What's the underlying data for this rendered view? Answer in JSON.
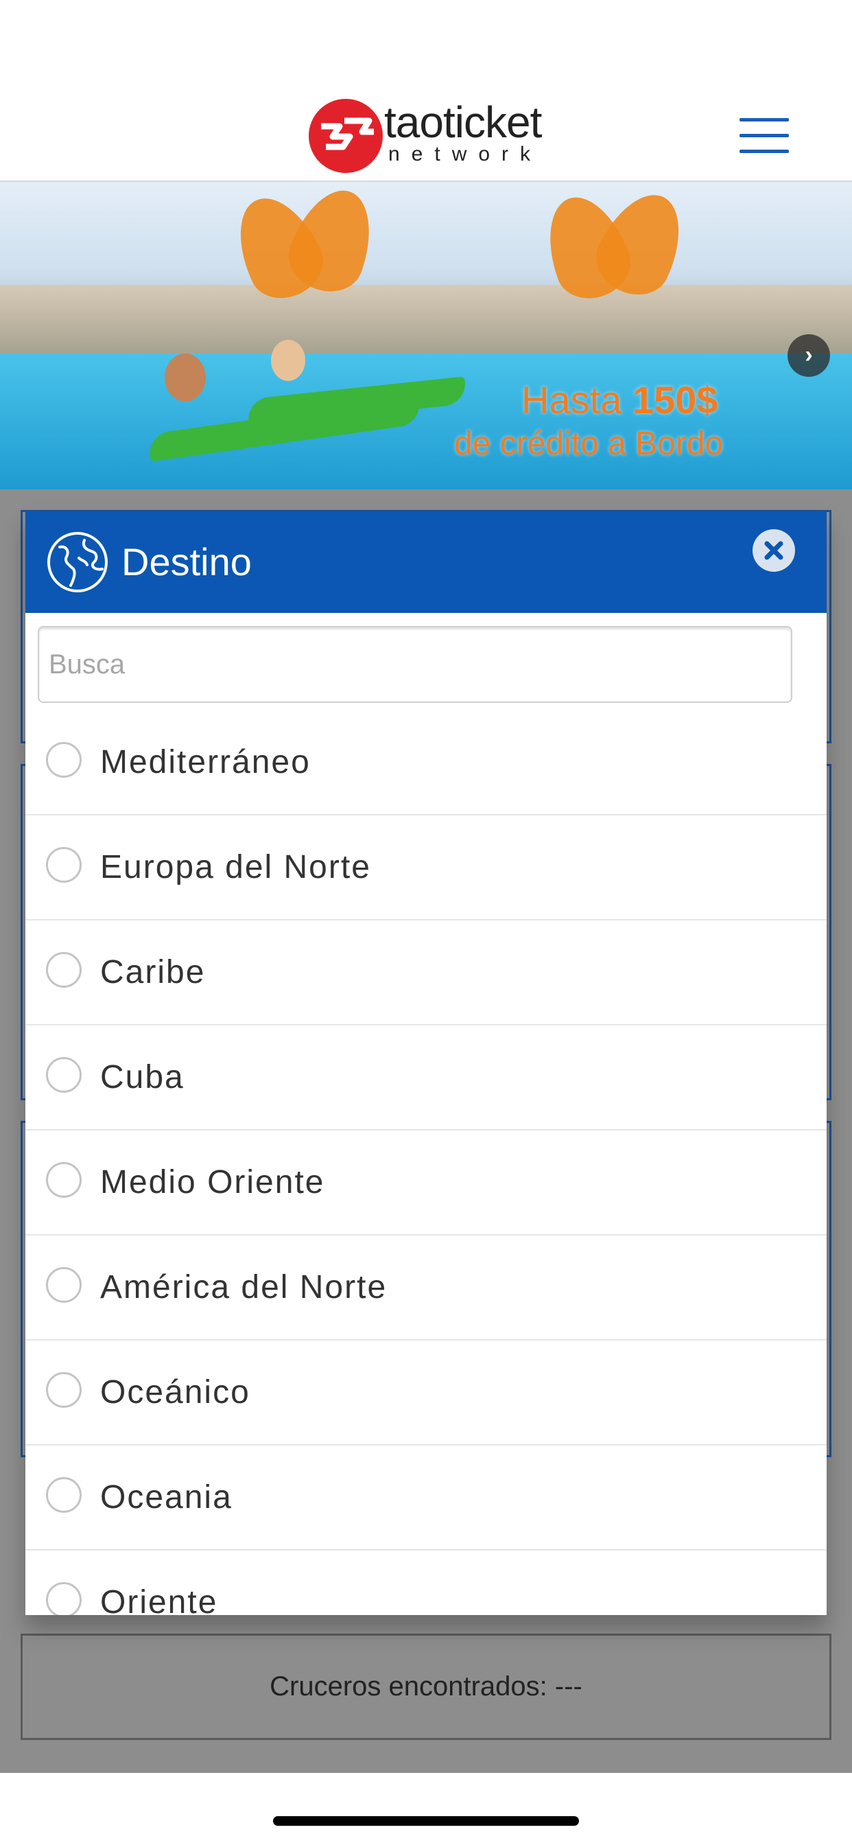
{
  "header": {
    "logo_word": "taoticket",
    "logo_sub": "network",
    "menu_icon": "hamburger-menu-icon"
  },
  "banner": {
    "promo_prefix": "Hasta ",
    "promo_amount": "150$",
    "promo_line2": "de crédito a Bordo",
    "next_icon": "chevron-right-icon",
    "next_glyph": "›"
  },
  "modal": {
    "title": "Destino",
    "title_icon": "globe-icon",
    "close_icon": "close-icon",
    "search_placeholder": "Busca",
    "search_value": "",
    "options": [
      {
        "label": "Mediterráneo"
      },
      {
        "label": "Europa del Norte"
      },
      {
        "label": "Caribe"
      },
      {
        "label": "Cuba"
      },
      {
        "label": "Medio Oriente"
      },
      {
        "label": "América del Norte"
      },
      {
        "label": "Oceánico"
      },
      {
        "label": "Oceania"
      },
      {
        "label": "Oriente"
      }
    ]
  },
  "results": {
    "count_text": "Cruceros encontrados: ---"
  },
  "colors": {
    "modal_header": "#0b57b3",
    "brand_red": "#e2222a",
    "menu_blue": "#1a5db4",
    "promo_orange": "#f47b20"
  }
}
